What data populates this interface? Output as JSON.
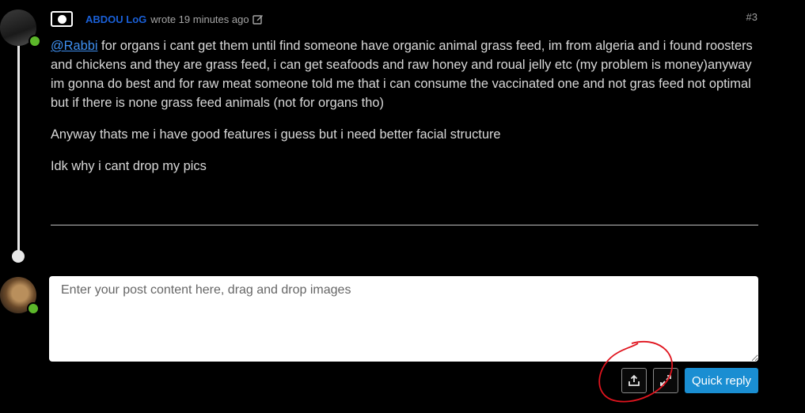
{
  "post": {
    "author": "ABDOU LoG",
    "wrote_text": "wrote 19 minutes ago",
    "index": "#3",
    "mention": "@Rabbi",
    "paragraph1_rest": " for organs i cant get them until find someone have organic animal grass feed, im from algeria and i found roosters and chickens and they are grass feed, i can get seafoods and raw honey and roual jelly etc (my problem is money)anyway im gonna do best and for raw meat someone told me that i can consume the vaccinated one and not gras feed not optimal but if there is none grass feed animals (not for organs tho)",
    "paragraph2": "Anyway thats me i have good features i guess but i need better facial structure",
    "paragraph3": "Idk why i cant drop my pics"
  },
  "composer": {
    "placeholder": "Enter your post content here, drag and drop images",
    "value": ""
  },
  "actions": {
    "upload_icon": "upload-icon",
    "expand_icon": "expand-icon",
    "quick_reply_label": "Quick reply"
  },
  "colors": {
    "background": "#000000",
    "username": "#1a60d8",
    "mention": "#3e8ff0",
    "online": "#5cb72a",
    "primary_button": "#1a8ed2",
    "annotation": "#e0141e"
  }
}
